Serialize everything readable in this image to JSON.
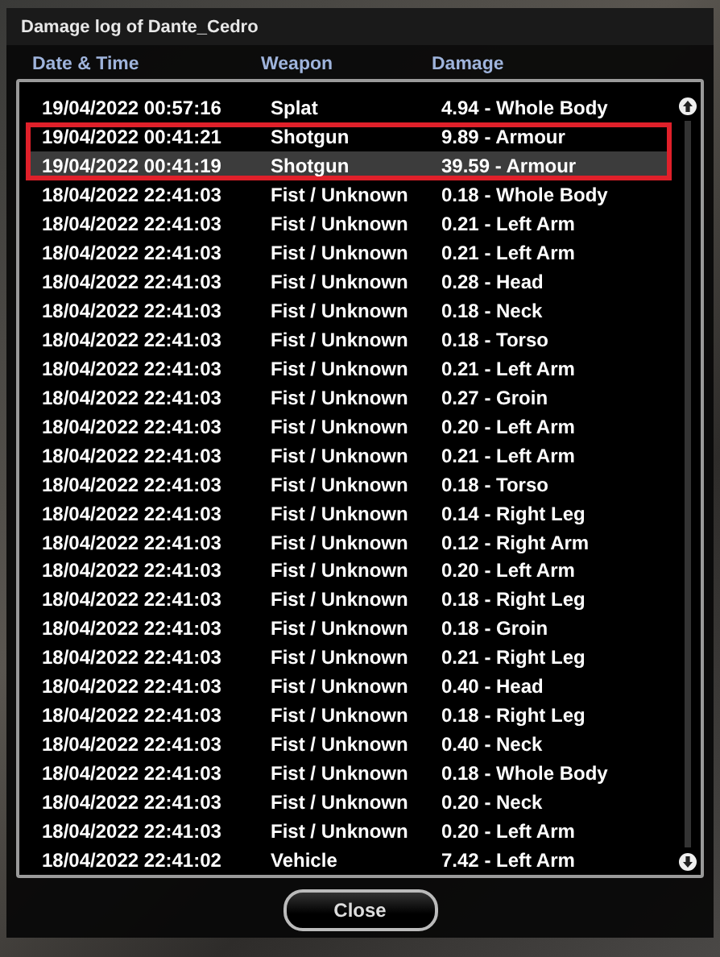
{
  "window": {
    "title": "Damage log of Dante_Cedro"
  },
  "table": {
    "columns": [
      "Date & Time",
      "Weapon",
      "Damage"
    ],
    "rows": [
      {
        "cells": [
          "19/04/2022 00:57:16",
          "Splat",
          "4.94 - Whole Body"
        ],
        "selected": false,
        "highlighted": false
      },
      {
        "cells": [
          "19/04/2022 00:41:21",
          "Shotgun",
          "9.89 - Armour"
        ],
        "selected": false,
        "highlighted": true
      },
      {
        "cells": [
          "19/04/2022 00:41:19",
          "Shotgun",
          "39.59 - Armour"
        ],
        "selected": true,
        "highlighted": true
      },
      {
        "cells": [
          "18/04/2022 22:41:03",
          "Fist / Unknown",
          "0.18 - Whole Body"
        ],
        "selected": false,
        "highlighted": false
      },
      {
        "cells": [
          "18/04/2022 22:41:03",
          "Fist / Unknown",
          "0.21 - Left Arm"
        ],
        "selected": false,
        "highlighted": false
      },
      {
        "cells": [
          "18/04/2022 22:41:03",
          "Fist / Unknown",
          "0.21 - Left Arm"
        ],
        "selected": false,
        "highlighted": false
      },
      {
        "cells": [
          "18/04/2022 22:41:03",
          "Fist / Unknown",
          "0.28 - Head"
        ],
        "selected": false,
        "highlighted": false
      },
      {
        "cells": [
          "18/04/2022 22:41:03",
          "Fist / Unknown",
          "0.18 - Neck"
        ],
        "selected": false,
        "highlighted": false
      },
      {
        "cells": [
          "18/04/2022 22:41:03",
          "Fist / Unknown",
          "0.18 - Torso"
        ],
        "selected": false,
        "highlighted": false
      },
      {
        "cells": [
          "18/04/2022 22:41:03",
          "Fist / Unknown",
          "0.21 - Left Arm"
        ],
        "selected": false,
        "highlighted": false
      },
      {
        "cells": [
          "18/04/2022 22:41:03",
          "Fist / Unknown",
          "0.27 - Groin"
        ],
        "selected": false,
        "highlighted": false
      },
      {
        "cells": [
          "18/04/2022 22:41:03",
          "Fist / Unknown",
          "0.20 - Left Arm"
        ],
        "selected": false,
        "highlighted": false
      },
      {
        "cells": [
          "18/04/2022 22:41:03",
          "Fist / Unknown",
          "0.21 - Left Arm"
        ],
        "selected": false,
        "highlighted": false
      },
      {
        "cells": [
          "18/04/2022 22:41:03",
          "Fist / Unknown",
          "0.18 - Torso"
        ],
        "selected": false,
        "highlighted": false
      },
      {
        "cells": [
          "18/04/2022 22:41:03",
          "Fist / Unknown",
          "0.14 - Right Leg"
        ],
        "selected": false,
        "highlighted": false
      },
      {
        "cells": [
          "18/04/2022 22:41:03",
          "Fist / Unknown",
          "0.12 - Right Arm"
        ],
        "selected": false,
        "highlighted": false
      },
      {
        "cells": [
          "18/04/2022 22:41:03",
          "Fist / Unknown",
          "0.20 - Left Arm"
        ],
        "selected": false,
        "highlighted": false
      },
      {
        "cells": [
          "18/04/2022 22:41:03",
          "Fist / Unknown",
          "0.18 - Right Leg"
        ],
        "selected": false,
        "highlighted": false
      },
      {
        "cells": [
          "18/04/2022 22:41:03",
          "Fist / Unknown",
          "0.18 - Groin"
        ],
        "selected": false,
        "highlighted": false
      },
      {
        "cells": [
          "18/04/2022 22:41:03",
          "Fist / Unknown",
          "0.21 - Right Leg"
        ],
        "selected": false,
        "highlighted": false
      },
      {
        "cells": [
          "18/04/2022 22:41:03",
          "Fist / Unknown",
          "0.40 - Head"
        ],
        "selected": false,
        "highlighted": false
      },
      {
        "cells": [
          "18/04/2022 22:41:03",
          "Fist / Unknown",
          "0.18 - Right Leg"
        ],
        "selected": false,
        "highlighted": false
      },
      {
        "cells": [
          "18/04/2022 22:41:03",
          "Fist / Unknown",
          "0.40 - Neck"
        ],
        "selected": false,
        "highlighted": false
      },
      {
        "cells": [
          "18/04/2022 22:41:03",
          "Fist / Unknown",
          "0.18 - Whole Body"
        ],
        "selected": false,
        "highlighted": false
      },
      {
        "cells": [
          "18/04/2022 22:41:03",
          "Fist / Unknown",
          "0.20 - Neck"
        ],
        "selected": false,
        "highlighted": false
      },
      {
        "cells": [
          "18/04/2022 22:41:03",
          "Fist / Unknown",
          "0.20 - Left Arm"
        ],
        "selected": false,
        "highlighted": false
      },
      {
        "cells": [
          "18/04/2022 22:41:02",
          "Vehicle",
          "7.42 - Left Arm"
        ],
        "selected": false,
        "highlighted": false
      }
    ]
  },
  "buttons": [
    "Close"
  ]
}
